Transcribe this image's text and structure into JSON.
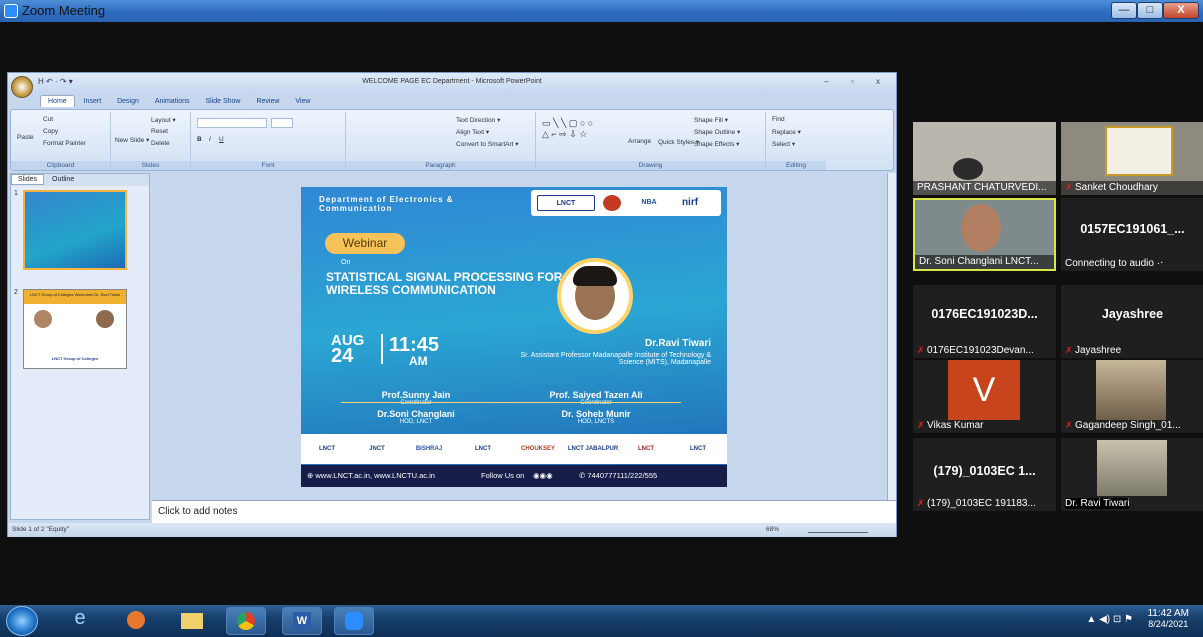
{
  "zoom": {
    "title": "Zoom Meeting",
    "min_label": "—",
    "max_label": "□",
    "close_label": "X"
  },
  "ppt": {
    "title": "WELCOME PAGE EC Department - Microsoft PowerPoint",
    "qat": "H  ↶ · ↷ ▾",
    "window_controls": "– ▫ x",
    "tabs": [
      "Home",
      "Insert",
      "Design",
      "Animations",
      "Slide Show",
      "Review",
      "View"
    ],
    "clipboard": {
      "paste": "Paste",
      "cut": "Cut",
      "copy": "Copy",
      "format_painter": "Format Painter",
      "group": "Clipboard"
    },
    "slides_group": {
      "new_slide": "New Slide ▾",
      "layout": "Layout ▾",
      "reset": "Reset",
      "delete": "Delete",
      "group": "Slides"
    },
    "font_group": {
      "group": "Font"
    },
    "paragraph_group": {
      "text_direction": "Text Direction ▾",
      "align_text": "Align Text ▾",
      "convert": "Convert to SmartArt ▾",
      "group": "Paragraph"
    },
    "drawing_group": {
      "arrange": "Arrange",
      "quick_styles": "Quick Styles ▾",
      "shape_fill": "Shape Fill ▾",
      "shape_outline": "Shape Outline ▾",
      "shape_effects": "Shape Effects ▾",
      "group": "Drawing"
    },
    "editing_group": {
      "find": "Find",
      "replace": "Replace ▾",
      "select": "Select ▾",
      "group": "Editing"
    },
    "pane_tabs": [
      "Slides",
      "Outline"
    ],
    "thumb2_header": "LNCT Group of Colleges Welcomes Dr. Ravi Tiwari",
    "thumb2_footer": "LNCT Group of Colleges",
    "notes_placeholder": "Click to add notes",
    "status_left": "Slide 1 of 2   \"Equity\"",
    "zoom_level": "68%"
  },
  "slide": {
    "dept": "Department of Electronics & Communication",
    "logos": [
      "LNCT",
      "NBA",
      "nirf"
    ],
    "webinar": "Webinar",
    "on": "On",
    "topic": "STATISTICAL SIGNAL PROCESSING FOR WIRELESS COMMUNICATION",
    "month": "AUG",
    "day": "24",
    "time": "11:45",
    "ampm": "AM",
    "speaker_name": "Dr.Ravi Tiwari",
    "speaker_desc": "Sr. Assistant Professor Madanapalle Institute of Technology & Science (MITS), Madanapalle",
    "coord1_name": "Prof.Sunny Jain",
    "coord1_role": "Coordinator",
    "coord2_name": "Prof. Saiyed Tazen Ali",
    "coord2_role": "Coordinator",
    "hod1_name": "Dr.Soni Changlani",
    "hod1_role": "HOD, LNCT",
    "hod2_name": "Dr. Soheb Munir",
    "hod2_role": "HOD, LNCTS",
    "partners": [
      "LNCT",
      "JNCT",
      "BISHRAJ",
      "LNCT",
      "CHOUKSEY",
      "LNCT JABALPUR",
      "LNCT",
      "LNCT"
    ],
    "footer_web": "⊕ www.LNCT.ac.in, www.LNCTU.ac.in",
    "footer_follow": "Follow Us on",
    "footer_phone": "✆ 7440777111/222/555"
  },
  "gallery": [
    {
      "name": "PRASHANT CHATURVEDI...",
      "muted": false
    },
    {
      "name": "Sanket Choudhary",
      "muted": true
    },
    {
      "name": "Dr. Soni Changlani LNCT...",
      "muted": false
    },
    {
      "big": "0157EC191061_...",
      "name": "Connecting to audio ·‧",
      "muted": false
    },
    {
      "big": "0176EC191023D...",
      "name": "0176EC191023Devan...",
      "muted": true
    },
    {
      "big": "Jayashree",
      "name": "Jayashree",
      "muted": true
    },
    {
      "letter": "V",
      "name": "Vikas Kumar",
      "muted": true
    },
    {
      "name": "Gagandeep Singh_01...",
      "muted": true
    },
    {
      "big": "(179)_0103EC 1...",
      "name": "(179)_0103EC 191183...",
      "muted": true
    },
    {
      "name": "Dr. Ravi Tiwari",
      "muted": false
    }
  ],
  "taskbar": {
    "time": "11:42 AM",
    "date": "8/24/2021",
    "tray": "▲ ◀) ⊡ ⚑"
  },
  "colors": {
    "speaking_border": "#d8e646",
    "accent": "#2d8cff"
  }
}
